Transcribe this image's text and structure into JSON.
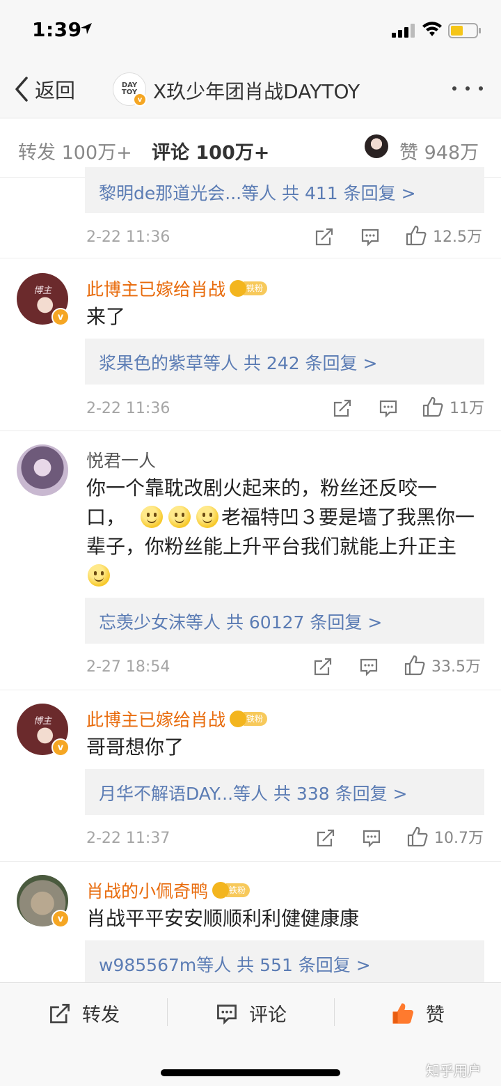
{
  "status_bar": {
    "time": "1:39"
  },
  "nav": {
    "back_label": "返回",
    "avatar_text_1": "DAY",
    "avatar_text_2": "TOY",
    "title": "X玖少年团肖战DAYTOY"
  },
  "tabs": {
    "repost": "转发 100万+",
    "comments": "评论 100万+",
    "likes": "赞 948万"
  },
  "top_partial": {
    "reply_summary": "黎明de那道光会...等人  共 411 条回复 >",
    "time": "2-22 11:36",
    "likes": "12.5万"
  },
  "comments": [
    {
      "user": "此博主已嫁给肖战",
      "badge": "铁粉",
      "text": "来了",
      "reply_summary": "浆果色的紫草等人  共 242 条回复 >",
      "time": "2-22 11:36",
      "likes": "11万",
      "avatar_text": "博主"
    },
    {
      "user": "悦君一人",
      "text_line1": "你一个靠耽改剧火起来的，粉丝还反咬一",
      "text_line2a": "口，",
      "text_line2b": "老福特凹３要是墙了我黑你一",
      "text_line3": "辈子，你粉丝能上升平台我们就能上升正主",
      "reply_summary": "忘羡少女沫等人  共 60127 条回复 >",
      "time": "2-27 18:54",
      "likes": "33.5万"
    },
    {
      "user": "此博主已嫁给肖战",
      "badge": "铁粉",
      "text": "哥哥想你了",
      "reply_summary": "月华不解语DAY...等人  共 338 条回复 >",
      "time": "2-22 11:37",
      "likes": "10.7万",
      "avatar_text": "博主"
    },
    {
      "user": "肖战的小佩奇鸭",
      "badge": "铁粉",
      "text": "肖战平平安安顺顺利利健健康康",
      "reply_summary": "w985567m等人  共 551 条回复 >"
    }
  ],
  "bottom_bar": {
    "repost": "转发",
    "comment": "评论",
    "like": "赞"
  },
  "watermark": "知乎用户",
  "colors": {
    "accent": "#fe8024",
    "username": "#e86b0c",
    "link": "#5b7cb4",
    "like_active": "#ff7a2e"
  }
}
